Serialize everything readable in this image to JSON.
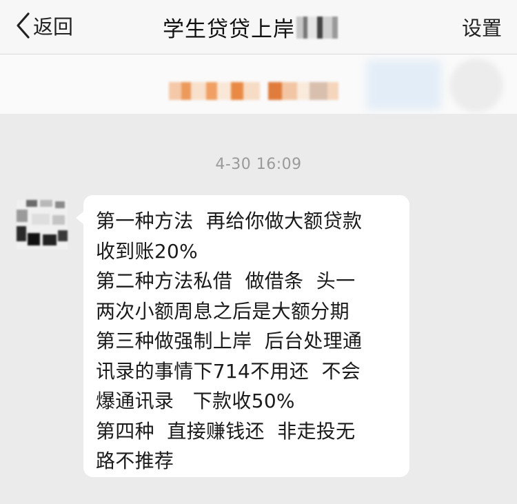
{
  "navbar": {
    "back_label": "返回",
    "title": "学生贷贷上岸",
    "settings_label": "设置"
  },
  "chat": {
    "timestamp": "4-30 16:09",
    "message_lines": [
      "第一种方法  再给你做大额贷款",
      "收到账20%",
      "第二种方法私借  做借条  头一",
      "两次小额周息之后是大额分期",
      "第三种做强制上岸  后台处理通",
      "讯录的事情下714不用还  不会",
      "爆通讯录   下款收50%",
      "第四种  直接赚钱还  非走投无",
      "路不推荐"
    ]
  },
  "icons": {
    "back": "chevron-left-icon"
  }
}
